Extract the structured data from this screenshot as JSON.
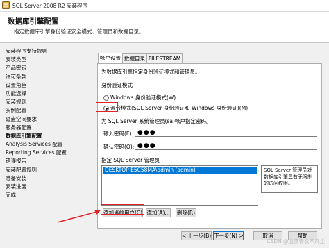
{
  "window": {
    "title": "SQL Server 2008 R2 安装程序",
    "icon": "sql-server-setup-icon"
  },
  "header": {
    "title": "数据库引擎配置",
    "description": "指定数据库引擎身份验证安全模式、管理员和数据目录。"
  },
  "nav": {
    "items": [
      "安装程序支持规则",
      "安装类型",
      "产品密钥",
      "许可条款",
      "设置角色",
      "功能选择",
      "安装规则",
      "实例配置",
      "磁盘空间要求",
      "服务器配置",
      "数据库引擎配置",
      "Analysis Services 配置",
      "Reporting Services 配置",
      "错误报告",
      "安装配置规则",
      "准备安装",
      "安装进度",
      "完成"
    ],
    "active_index": 10
  },
  "tabs": [
    "帐户设置",
    "数据目录",
    "FILESTREAM"
  ],
  "account": {
    "intro": "为数据库引擎指定身份验证模式和管理员。",
    "auth_group_label": "身份验证模式",
    "windows_auth": "Windows 身份验证模式(W)",
    "mixed_auth": "混合模式(SQL Server 身份验证和 Windows 身份验证)(M)",
    "selected_mode": "mixed",
    "sa_note": "为 SQL Server 系统管理员(sa)帐户指定密码。",
    "password_label": "输入密码(E):",
    "password_value": "●●●",
    "confirm_label": "确认密码(O):",
    "confirm_value": "●●●",
    "admins_group_label": "指定 SQL Server 管理员",
    "admins": [
      "DESKTOP-E5C58MA\\admin (admin)"
    ],
    "admin_info": "SQL Server 管理员对数据库引擎具有无限制的访问权限。",
    "add_current_user": "添加当前用户(C)",
    "add": "添加(A)...",
    "remove": "删除(R)"
  },
  "footer": {
    "back": "< 上一步(B)",
    "next": "下一步(N) >",
    "cancel": "取消",
    "help": "帮助"
  },
  "watermark": "CSDN @血狼青衣不凡尘",
  "colors": {
    "highlight": "#e0212a",
    "selection": "#0078d7",
    "accent_bar": "#1e90ff"
  }
}
